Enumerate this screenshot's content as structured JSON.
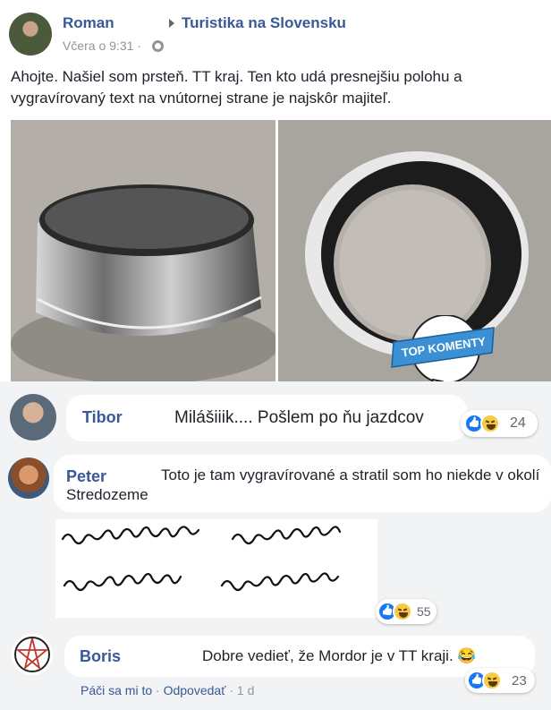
{
  "post": {
    "author": "Roman",
    "group": "Turistika na Slovensku",
    "time": "Včera o 9:31 ·",
    "text": "Ahojte. Našiel som prsteň. TT kraj. Ten kto udá presnejšiu polohu a vygravírovaný text na vnútornej strane je najskôr majiteľ."
  },
  "badge": {
    "label": "TOP KOMENTY",
    "color": "#3b8fd4"
  },
  "comments": [
    {
      "name": "Tibor",
      "text": "Milášiiik.... Pošlem po ňu jazdcov",
      "reactions": "24"
    },
    {
      "name": "Peter",
      "text": "Toto je tam vygravírované a stratil som ho niekde v okolí Stredozeme",
      "reactions": "55"
    },
    {
      "name": "Boris",
      "text": "Dobre vedieť, že Mordor je v TT kraji. 😂",
      "reactions": "23"
    }
  ],
  "actions": {
    "like": "Páči sa mi to",
    "sep": "·",
    "reply": "Odpovedať",
    "time": "1 d"
  },
  "icons": {
    "globe": "globe-icon",
    "like": "like-reaction-icon",
    "haha": "haha-reaction-icon"
  },
  "colors": {
    "link": "#385898",
    "meta": "#90949c",
    "comment_bg": "#f2f3f5"
  }
}
